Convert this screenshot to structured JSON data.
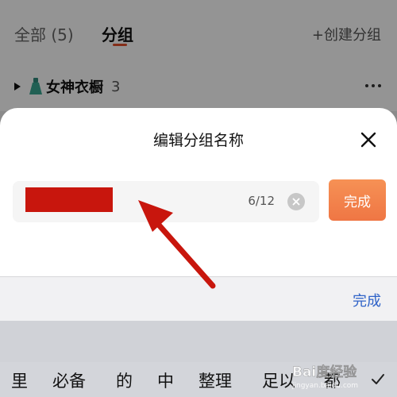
{
  "background": {
    "tabs": [
      {
        "label": "全部 (5)"
      },
      {
        "label": "分组"
      }
    ],
    "create_group": "+创建分组",
    "group_row": {
      "name": "女神衣橱",
      "count": "3"
    }
  },
  "dialog": {
    "title": "编辑分组名称",
    "input": {
      "value": "",
      "char_count": "6/12"
    },
    "done_label": "完成"
  },
  "accessory": {
    "done_label": "完成"
  },
  "keyboard": {
    "candidates": [
      "里",
      "必备",
      "的",
      "中",
      "整理",
      "足以",
      "都"
    ]
  },
  "watermark": {
    "text": "Bai度经验",
    "subtext": "jingyan.baidu.com"
  },
  "colors": {
    "accent": "#ef7644",
    "tab_underline": "#e4502b",
    "link_blue": "#2f63c8",
    "redaction": "#c8160d",
    "arrow": "#c8160d"
  }
}
